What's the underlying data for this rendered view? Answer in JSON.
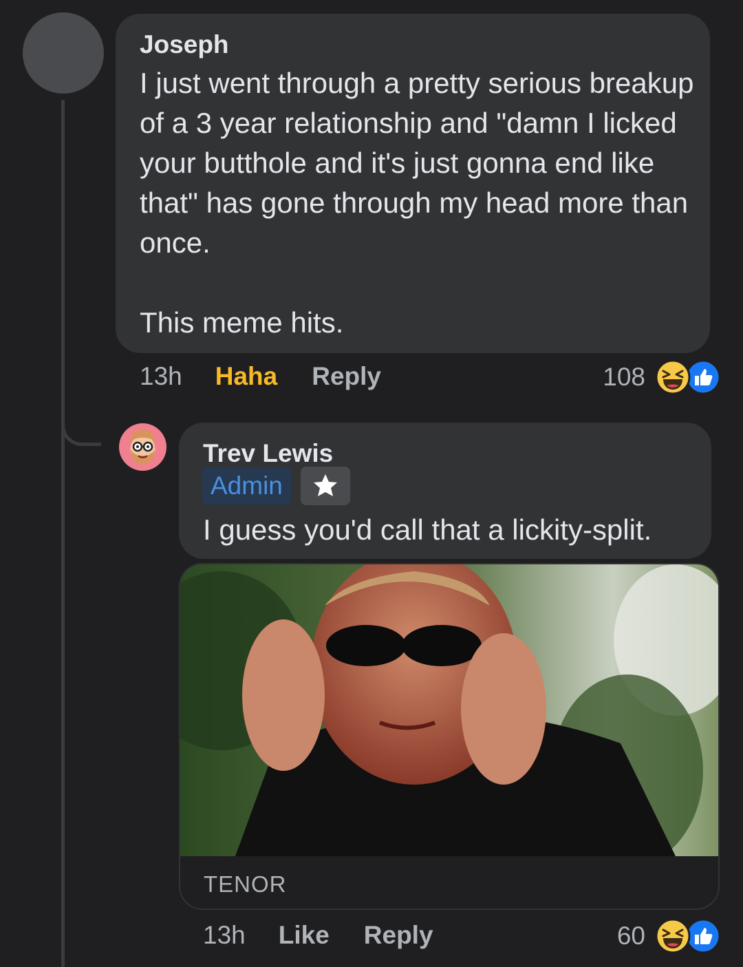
{
  "comment": {
    "author": "Joseph",
    "text": "I just went through a pretty serious breakup of a 3 year relationship and \"damn I licked your butthole and it's just gonna end like that\" has gone through my head more than once.\n\nThis meme hits.",
    "time": "13h",
    "reaction_label": "Haha",
    "reply_label": "Reply",
    "reaction_count": "108",
    "reaction_icons": [
      "haha-icon",
      "like-icon"
    ]
  },
  "reply": {
    "author": "Trev Lewis",
    "badge": "Admin",
    "badge_icon": "star-icon",
    "text": "I guess you'd call that a lickity-split.",
    "gif_source": "TENOR",
    "time": "13h",
    "like_label": "Like",
    "reply_label": "Reply",
    "reaction_count": "60",
    "reaction_icons": [
      "haha-icon",
      "like-icon"
    ]
  },
  "colors": {
    "background": "#1f1f21",
    "bubble": "#323335",
    "haha_accent": "#f7b928",
    "admin_badge_text": "#4a90e2",
    "like_blue": "#1877f2"
  }
}
